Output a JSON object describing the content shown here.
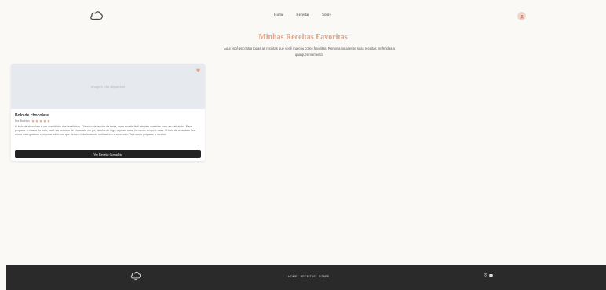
{
  "header": {
    "nav": [
      {
        "label": "Home"
      },
      {
        "label": "Receitas"
      },
      {
        "label": "Sobre"
      }
    ]
  },
  "main": {
    "title": "Minhas Receitas Favoritas",
    "subtitle": "Aqui você encontra todas as receitas que você marcou como favoritas. Remova ou acesse suas receitas preferidas a qualquer momento!"
  },
  "cards": [
    {
      "image_placeholder": "Imagem não disponível",
      "title": "Bolo de chocolate",
      "author": "Por Bolinho",
      "rating": 5,
      "description": "O bolo de chocolate é um queridinho das brasileiras. Clássico da lanche da tarde, essa receita fácil simples combina com um cafezinho. Para preparar a massa do bolo, você vai precisar de chocolate em pó, farinha de trigo, açúcar, ovos, fermento em pó e mais. O bolo de chocolate fica ainda mais gostoso com uma cobertura que deixa o bolo bastante molhadinho e saboroso. Veja como preparar a receita!",
      "button_label": "Ver Receita Completa"
    }
  ],
  "footer": {
    "nav": [
      {
        "label": "HOME"
      },
      {
        "label": "RECEITAS"
      },
      {
        "label": "SOBRE"
      }
    ]
  },
  "colors": {
    "accent": "#e3a386",
    "footer_bg": "#2a2a2a",
    "button_bg": "#222222"
  },
  "icons": {
    "logo": "cloud-outline-icon",
    "avatar": "user-icon",
    "favorite": "heart-icon",
    "star": "star-icon",
    "social": [
      "instagram-icon",
      "youtube-icon"
    ]
  }
}
